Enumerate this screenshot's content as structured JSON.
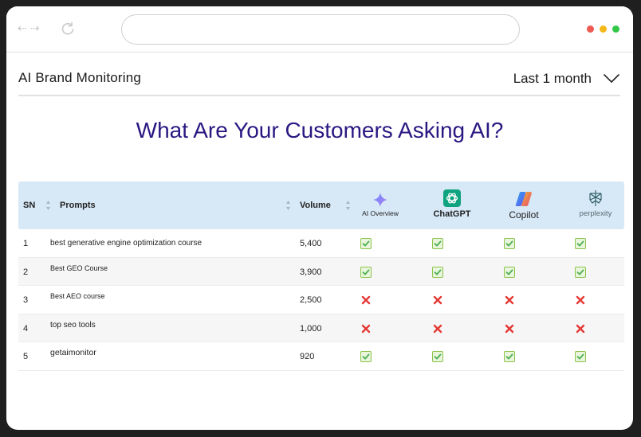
{
  "header": {
    "title": "AI Brand Monitoring",
    "period": "Last 1 month"
  },
  "main": {
    "heading": "What Are Your Customers Asking AI?"
  },
  "table": {
    "columns": {
      "sn": "SN",
      "prompts": "Prompts",
      "volume": "Volume"
    },
    "engines": [
      {
        "name": "AI Overview",
        "icon": "sparkle-icon"
      },
      {
        "name": "ChatGPT",
        "icon": "chatgpt-logo-icon"
      },
      {
        "name": "Copilot",
        "icon": "copilot-logo-icon"
      },
      {
        "name": "perplexity",
        "icon": "perplexity-logo-icon"
      }
    ],
    "rows": [
      {
        "sn": "1",
        "prompt": "best generative engine optimization course",
        "volume": "5,400",
        "results": [
          true,
          true,
          true,
          true
        ]
      },
      {
        "sn": "2",
        "prompt": "Best GEO Course",
        "volume": "3,900",
        "results": [
          true,
          true,
          true,
          true
        ]
      },
      {
        "sn": "3",
        "prompt": "Best AEO course",
        "volume": "2,500",
        "results": [
          false,
          false,
          false,
          false
        ]
      },
      {
        "sn": "4",
        "prompt": "top seo tools",
        "volume": "1,000",
        "results": [
          false,
          false,
          false,
          false
        ]
      },
      {
        "sn": "5",
        "prompt": "getaimonitor",
        "volume": "920",
        "results": [
          true,
          true,
          true,
          true
        ]
      }
    ]
  },
  "colors": {
    "heading": "#2b1782",
    "table_header_bg": "#d7e8f6",
    "check_green": "#4caf50",
    "cross_red": "#e53935",
    "light_red": "#ee5a52",
    "light_yellow": "#f5b81a",
    "light_green": "#33c748"
  }
}
